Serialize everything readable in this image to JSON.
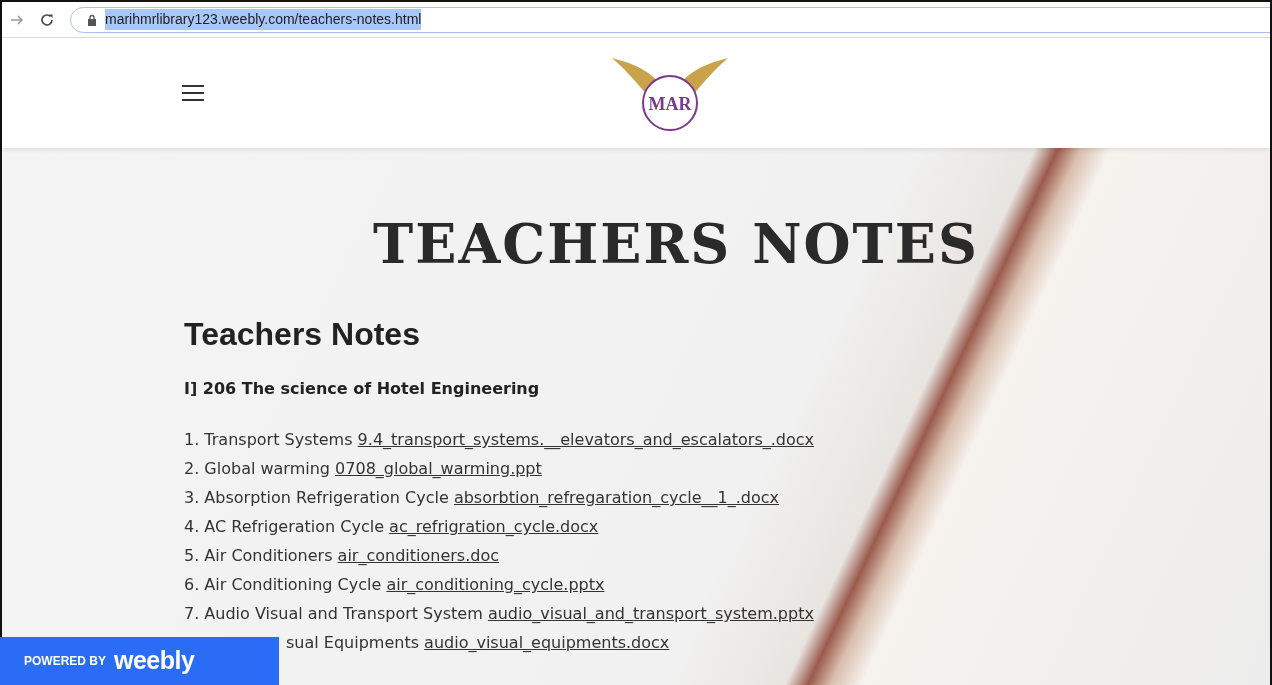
{
  "browser": {
    "url": "marihmrlibrary123.weebly.com/teachers-notes.html",
    "url_selected": true
  },
  "header": {
    "logo_text": "MAR"
  },
  "hero": {
    "title": "TEACHERS NOTES"
  },
  "content": {
    "heading": "Teachers Notes",
    "section": "I] 206 The science of Hotel Engineering",
    "items": [
      {
        "kind": "full",
        "label": "1. Transport Systems",
        "link": "9.4_transport_systems.__elevators_and_escalators_.docx"
      },
      {
        "kind": "full",
        "label": "2. Global warming",
        "link": "0708_global_warming.ppt"
      },
      {
        "kind": "full",
        "label": "3. Absorption Refrigeration Cycle",
        "link": "absorbtion_refregaration_cycle__1_.docx"
      },
      {
        "kind": "full",
        "label": "4. AC Refrigeration Cycle",
        "link": "ac_refrigration_cycle.docx"
      },
      {
        "kind": "full",
        "label": "5. Air Conditioners",
        "link": "air_conditioners.doc"
      },
      {
        "kind": "full",
        "label": "6. Air Conditioning Cycle",
        "link": "air_conditioning_cycle.pptx"
      },
      {
        "kind": "full",
        "label": "7. Audio Visual and Transport System",
        "link": "audio_visual_and_transport_system.pptx"
      },
      {
        "kind": "covered",
        "label": "sual Equipments",
        "link": "audio_visual_equipments.docx"
      }
    ]
  },
  "badge": {
    "prefix": "POWERED BY",
    "brand": "weebly"
  }
}
